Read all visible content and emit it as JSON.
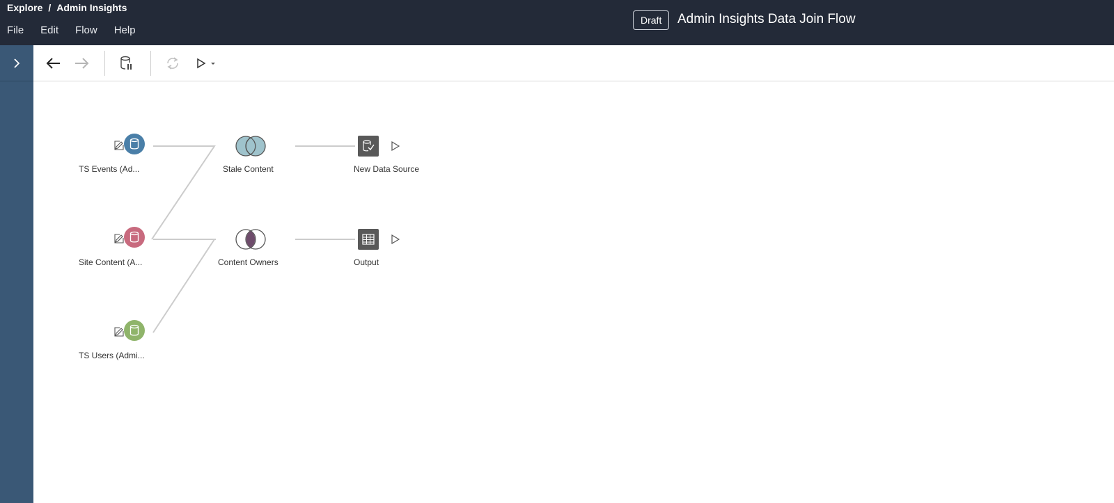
{
  "header": {
    "breadcrumb": {
      "root": "Explore",
      "separator": "/",
      "current": "Admin Insights"
    },
    "menu": [
      "File",
      "Edit",
      "Flow",
      "Help"
    ],
    "badge": "Draft",
    "title": "Admin Insights Data Join Flow"
  },
  "toolbar": {
    "items": [
      "back-arrow-icon",
      "forward-arrow-icon",
      "pause-data-updates-icon",
      "refresh-icon",
      "run-flow-icon",
      "dropdown-caret-icon"
    ]
  },
  "flow": {
    "inputs": [
      {
        "label": "TS Events (Ad...",
        "color": "#4a7fa8"
      },
      {
        "label": "Site Content (A...",
        "color": "#c86a7e"
      },
      {
        "label": "TS Users (Admi...",
        "color": "#8fb46a"
      }
    ],
    "joins": [
      {
        "label": "Stale Content",
        "type": "full-join",
        "fill": "#9fc3cc"
      },
      {
        "label": "Content Owners",
        "type": "inner-join",
        "fill": "#6e4c6b"
      }
    ],
    "outputs": [
      {
        "label": "New Data Source",
        "icon": "published-data-source-icon"
      },
      {
        "label": "Output",
        "icon": "table-output-icon"
      }
    ]
  },
  "colors": {
    "topbar": "#232a38",
    "sidebar": "#3a5876",
    "connector": "#cccccc"
  }
}
